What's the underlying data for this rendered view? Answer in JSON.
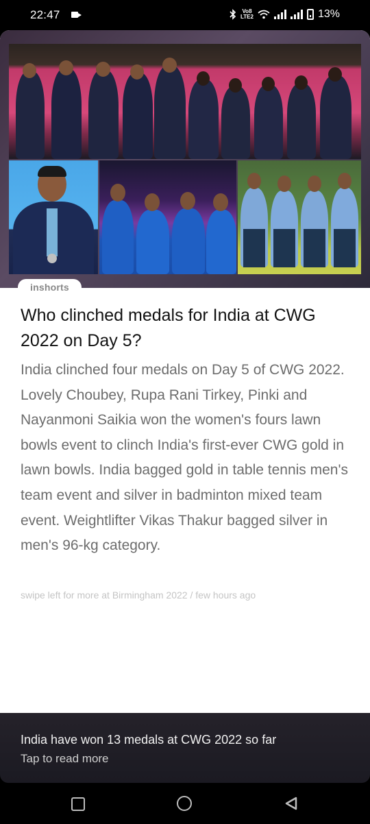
{
  "status_bar": {
    "time": "22:47",
    "lte_label": "LTE2",
    "volte_label": "Vo8",
    "battery": "13%"
  },
  "card": {
    "brand": "inshorts",
    "headline": "Who clinched medals for India at CWG 2022 on Day 5?",
    "body": "India clinched four medals on Day 5 of CWG 2022. Lovely Choubey, Rupa Rani Tirkey, Pinki and Nayanmoni Saikia won the women's fours lawn bowls event to clinch India's first-ever CWG gold in lawn bowls. India bagged gold in table tennis men's team event and silver in badminton mixed team event. Weightlifter Vikas Thakur bagged silver in men's 96-kg category.",
    "attribution": "swipe left for more at Birmingham 2022 / few hours ago"
  },
  "footer": {
    "title": "India have won 13 medals at CWG 2022 so far",
    "subtitle": "Tap to read more"
  },
  "colors": {
    "accent_pink": "#d6487a",
    "india_blue": "#1d56b8"
  },
  "icons": {
    "nav_recents": "square",
    "nav_home": "circle",
    "nav_back": "triangle-left"
  }
}
